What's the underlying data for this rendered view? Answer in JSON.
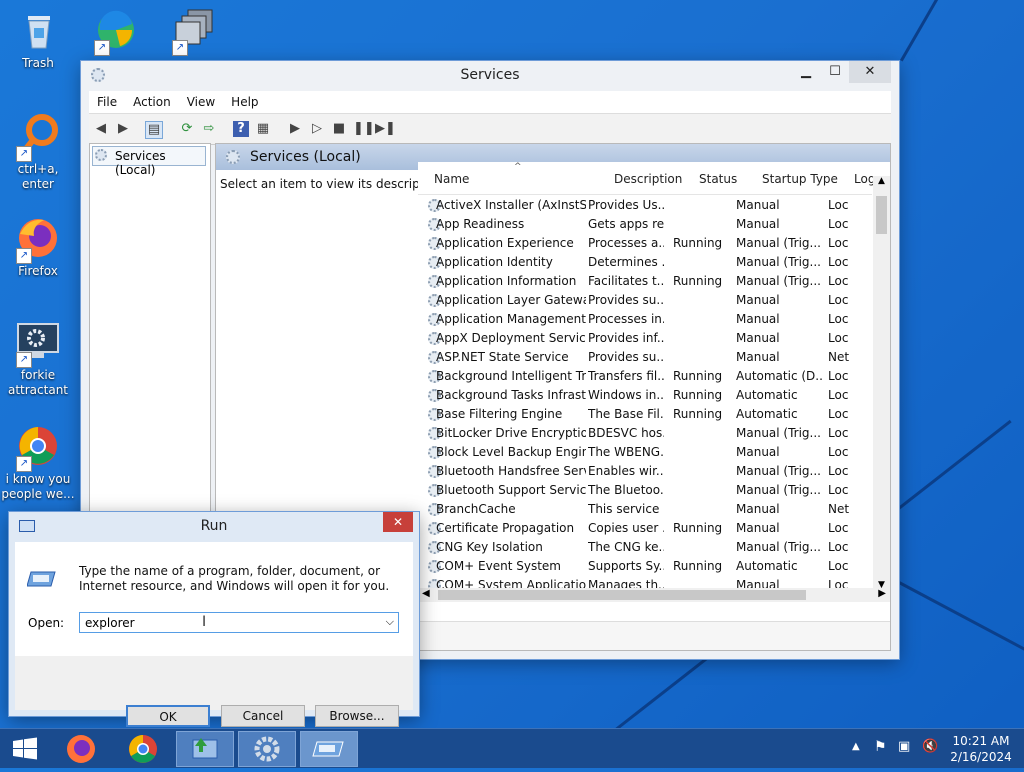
{
  "desktop": {
    "icons": [
      {
        "label": "Trash"
      },
      {
        "label": ""
      },
      {
        "label": ""
      },
      {
        "label": "ctrl+a, enter"
      },
      {
        "label": "Firefox"
      },
      {
        "label": "forkie attractant"
      },
      {
        "label": "i know you people we..."
      }
    ]
  },
  "services": {
    "title": "Services",
    "menu": [
      "File",
      "Action",
      "View",
      "Help"
    ],
    "tree_item": "Services (Local)",
    "header_title": "Services (Local)",
    "description_prompt": "Select an item to view its description.",
    "columns": [
      "Name",
      "Description",
      "Status",
      "Startup Type",
      "Log"
    ],
    "rows": [
      [
        "ActiveX Installer (AxInstSV)",
        "Provides Us...",
        "",
        "Manual",
        "Loc"
      ],
      [
        "App Readiness",
        "Gets apps re...",
        "",
        "Manual",
        "Loc"
      ],
      [
        "Application Experience",
        "Processes a...",
        "Running",
        "Manual (Trig...",
        "Loc"
      ],
      [
        "Application Identity",
        "Determines ...",
        "",
        "Manual (Trig...",
        "Loc"
      ],
      [
        "Application Information",
        "Facilitates t...",
        "Running",
        "Manual (Trig...",
        "Loc"
      ],
      [
        "Application Layer Gateway ...",
        "Provides su...",
        "",
        "Manual",
        "Loc"
      ],
      [
        "Application Management",
        "Processes in...",
        "",
        "Manual",
        "Loc"
      ],
      [
        "AppX Deployment Service (...",
        "Provides inf...",
        "",
        "Manual",
        "Loc"
      ],
      [
        "ASP.NET State Service",
        "Provides su...",
        "",
        "Manual",
        "Net"
      ],
      [
        "Background Intelligent Tran...",
        "Transfers fil...",
        "Running",
        "Automatic (D...",
        "Loc"
      ],
      [
        "Background Tasks Infrastru...",
        "Windows in...",
        "Running",
        "Automatic",
        "Loc"
      ],
      [
        "Base Filtering Engine",
        "The Base Fil...",
        "Running",
        "Automatic",
        "Loc"
      ],
      [
        "BitLocker Drive Encryption ...",
        "BDESVC hos...",
        "",
        "Manual (Trig...",
        "Loc"
      ],
      [
        "Block Level Backup Engine ...",
        "The WBENG...",
        "",
        "Manual",
        "Loc"
      ],
      [
        "Bluetooth Handsfree Service",
        "Enables wir...",
        "",
        "Manual (Trig...",
        "Loc"
      ],
      [
        "Bluetooth Support Service",
        "The Bluetoo...",
        "",
        "Manual (Trig...",
        "Loc"
      ],
      [
        "BranchCache",
        "This service ...",
        "",
        "Manual",
        "Net"
      ],
      [
        "Certificate Propagation",
        "Copies user ...",
        "Running",
        "Manual",
        "Loc"
      ],
      [
        "CNG Key Isolation",
        "The CNG ke...",
        "",
        "Manual (Trig...",
        "Loc"
      ],
      [
        "COM+ Event System",
        "Supports Sy...",
        "Running",
        "Automatic",
        "Loc"
      ],
      [
        "COM+ System Application",
        "Manages th...",
        "",
        "Manual",
        "Loc"
      ]
    ]
  },
  "run": {
    "title": "Run",
    "close_glyph": "✕",
    "description": "Type the name of a program, folder, document, or Internet resource, and Windows will open it for you.",
    "open_label": "Open:",
    "input_value": "explorer",
    "ok_label": "OK",
    "cancel_label": "Cancel",
    "browse_label": "Browse..."
  },
  "taskbar": {
    "time": "10:21 AM",
    "date": "2/16/2024"
  },
  "colors": {
    "desktop": "#1a6fd0",
    "taskbar": "#1a4b8e",
    "close_red": "#c7403a"
  }
}
